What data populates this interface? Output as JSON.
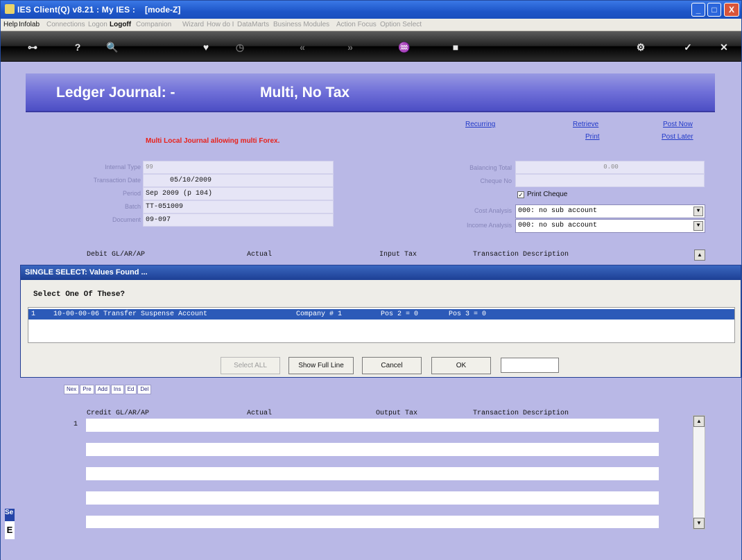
{
  "window": {
    "title": "IES Client(Q) v8.21 : My IES :",
    "mode": "[mode-Z]",
    "min_symbol": "_",
    "max_symbol": "□",
    "close_symbol": "X"
  },
  "menu": {
    "items": [
      "Help",
      "Infolab",
      "Connections",
      "Logon",
      "Logoff",
      "Companion",
      "Wizard",
      "How do I",
      "DataMarts",
      "Business Modules",
      "Action Focus",
      "Option Select"
    ]
  },
  "toolbar": {
    "icons": [
      "key-icon",
      "help-icon",
      "search-icon",
      "heart-icon",
      "clock-icon",
      "rewind-icon",
      "forward-icon",
      "tree-icon",
      "stop-icon",
      "refresh-icon",
      "check-icon",
      "close-icon"
    ],
    "glyphs": [
      "⊶",
      "?",
      "🔍",
      "♥",
      "◷",
      "«",
      "»",
      "♒",
      "■",
      "⚙",
      "✓",
      "✕"
    ]
  },
  "banner": {
    "title": "Ledger Journal: -",
    "subtitle": "Multi, No Tax"
  },
  "links": {
    "recurring": "Recurring",
    "retrieve": "Retrieve",
    "print": "Print",
    "post_now": "Post Now",
    "post_later": "Post Later"
  },
  "message": "Multi Local Journal allowing multi Forex.",
  "form": {
    "internal_type_label": "Internal Type",
    "internal_type": "99",
    "transaction_date_label": "Transaction Date",
    "transaction_date": "05/10/2009",
    "period_label": "Period",
    "period": "Sep 2009 (p 104)",
    "batch_label": "Batch",
    "batch": "TT-051009",
    "document_label": "Document",
    "document": "09-097",
    "balancing_total_label": "Balancing Total",
    "balancing_total": "0.00",
    "cheque_no_label": "Cheque No",
    "cheque_no": "",
    "print_cheque_label": "Print Cheque",
    "print_cheque_checked": true,
    "cost_analysis_label": "Cost Analysis",
    "cost_analysis": "000: no sub account",
    "income_analysis_label": "Income Analysis",
    "income_analysis": "000: no sub account"
  },
  "debit_grid": {
    "headers": [
      "Debit GL/AR/AP",
      "Actual",
      "Input Tax",
      "Transaction Description"
    ]
  },
  "row_buttons": [
    "Nex",
    "Pre",
    "Add",
    "Ins",
    "Ed",
    "Del"
  ],
  "credit_grid": {
    "headers": [
      "Credit GL/AR/AP",
      "Actual",
      "Output Tax",
      "Transaction Description"
    ],
    "row_number": "1"
  },
  "dialog": {
    "title": "SINGLE SELECT: Values Found ...",
    "prompt": "Select One Of These?",
    "row": {
      "index": "1",
      "account": "10-00-00-06 Transfer Suspense Account",
      "company": "Company # 1",
      "pos2": "Pos 2 = 0",
      "pos3": "Pos 3 = 0"
    },
    "buttons": {
      "select_all": "Select ALL",
      "show_full_line": "Show Full Line",
      "cancel": "Cancel",
      "ok": "OK"
    },
    "input_value": ""
  },
  "left_tab": {
    "label": "Se",
    "glyph": "E"
  }
}
